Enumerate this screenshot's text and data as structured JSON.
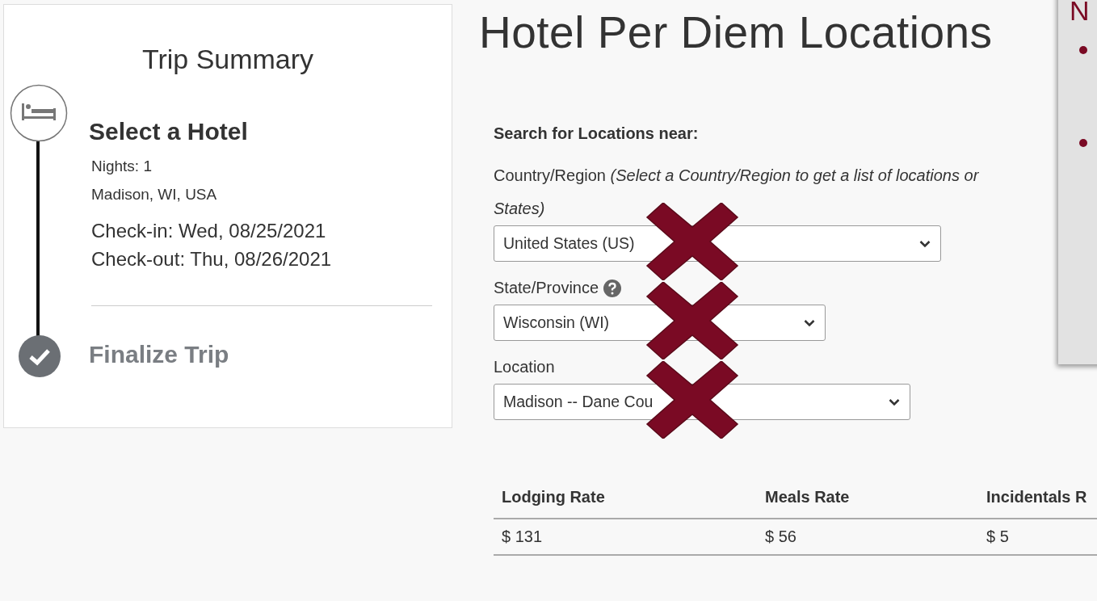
{
  "trip_summary": {
    "title": "Trip Summary",
    "steps": [
      {
        "kind": "hotel",
        "title": "Select a Hotel",
        "active": true,
        "details": [
          "Nights: 1",
          "Madison, WI, USA"
        ],
        "dates": [
          "Check-in: Wed, 08/25/2021",
          "Check-out: Thu, 08/26/2021"
        ]
      },
      {
        "kind": "finalize",
        "title": "Finalize Trip",
        "active": false
      }
    ]
  },
  "page_title": "Hotel Per Diem Locations",
  "search": {
    "heading": "Search for Locations near:",
    "fields": [
      {
        "label": "Country/Region *(Select a Country/Region to get a list of locations or States)*",
        "value": "United States (US)",
        "crossed_out": true
      },
      {
        "label": "State/Province",
        "help": true,
        "value": "Wisconsin (WI)",
        "crossed_out": true
      },
      {
        "label": "Location",
        "value": "Madison -- Dane Cou",
        "crossed_out": true
      }
    ]
  },
  "rates_table": {
    "columns": [
      "Lodging Rate",
      "Meals Rate",
      "Incidentals R"
    ],
    "rows": [
      [
        "$ 131",
        "$ 56",
        "$ 5"
      ]
    ]
  },
  "callout": {
    "heading": "N"
  }
}
